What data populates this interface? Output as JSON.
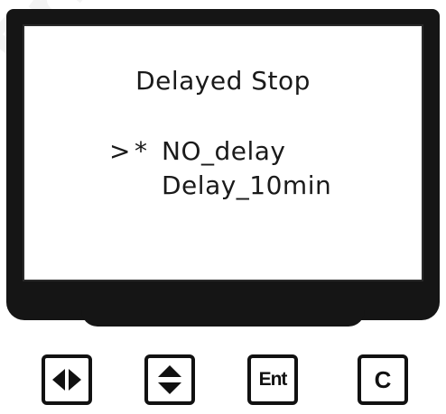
{
  "screen": {
    "title": "Delayed Stop",
    "cursor_glyph": ">",
    "selected_marker": "*",
    "options": [
      {
        "label": "NO_delay",
        "selected": true
      },
      {
        "label": "Delay_10min",
        "selected": false
      }
    ]
  },
  "keypad": {
    "left_right_icon": "left-right-arrows-icon",
    "up_down_icon": "up-down-arrows-icon",
    "enter_label": "Ent",
    "clear_label": "C"
  },
  "watermark": "Printed copy",
  "colors": {
    "bezel": "#151515",
    "screen_bg": "#ffffff",
    "text": "#1a1a1a"
  }
}
